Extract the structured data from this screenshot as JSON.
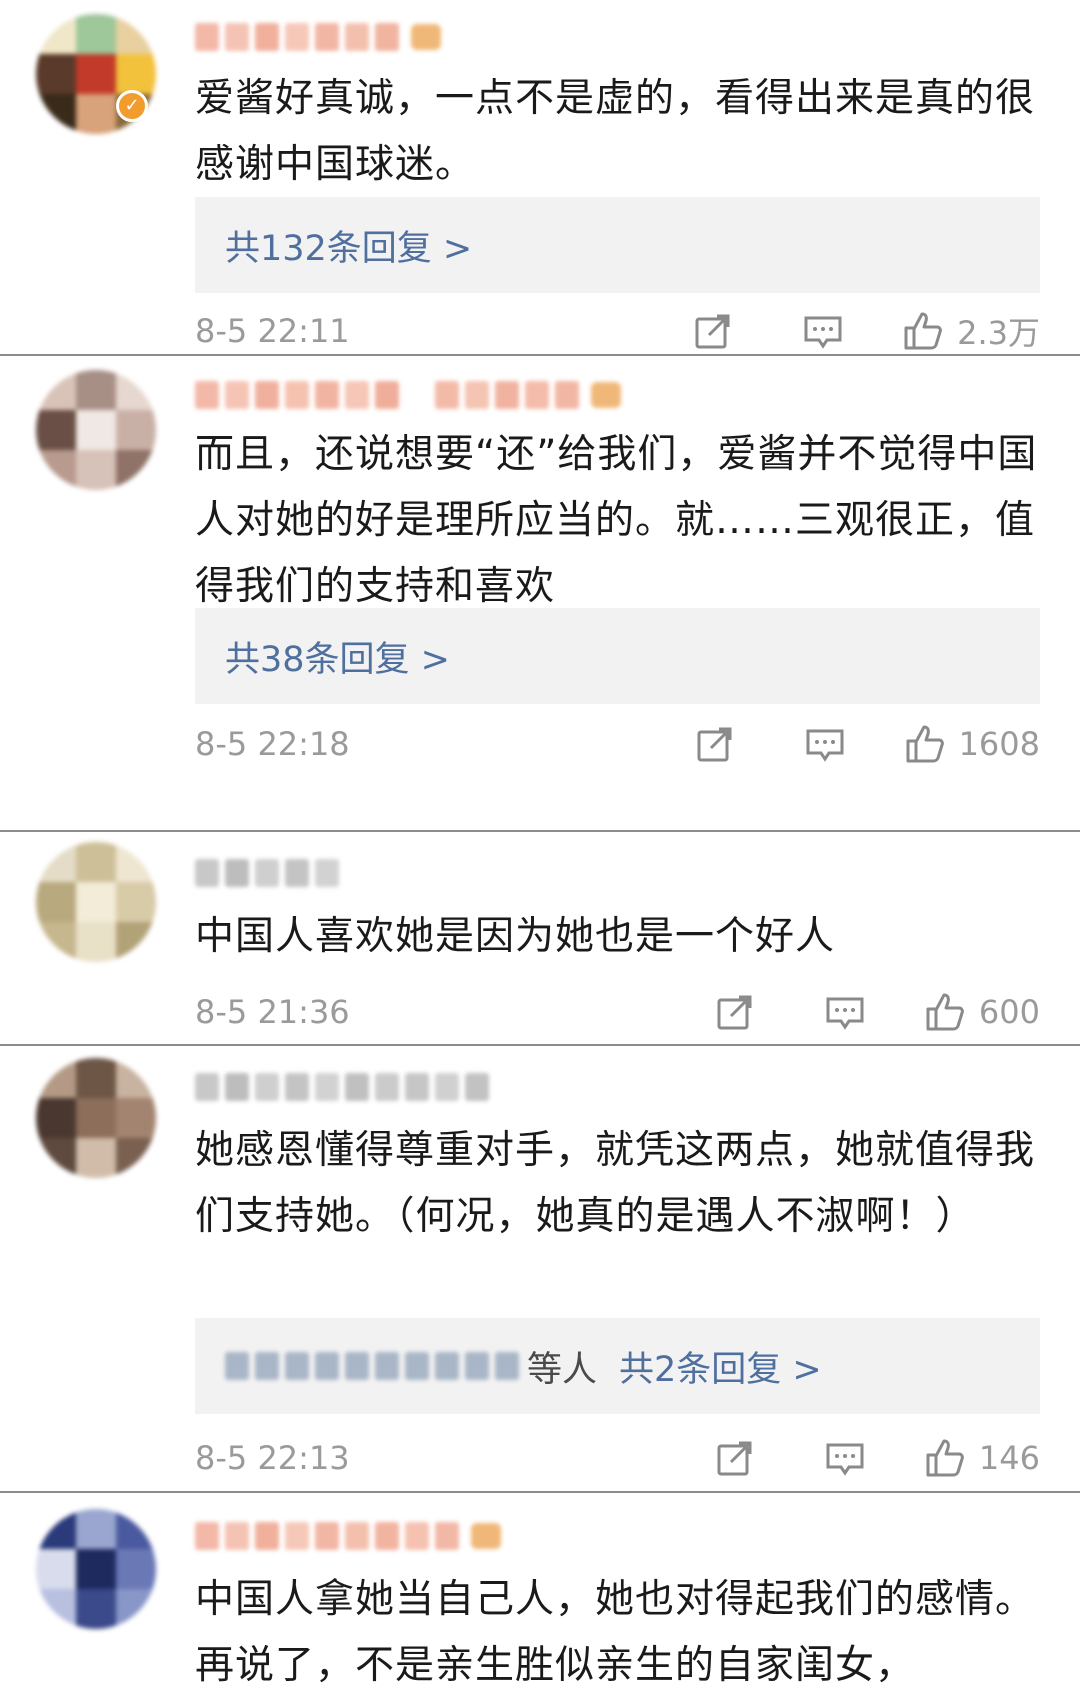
{
  "comments": [
    {
      "username": "",
      "verified": true,
      "text": "爱酱好真诚，一点不是虚的，看得出来是真的很感谢中国球迷。",
      "reply_label": "共132条回复 >",
      "reply_prefix": "",
      "time": "8-5 22:11",
      "likes": "2.3万",
      "avatar_colors": [
        "#f0e6c8",
        "#9ec79a",
        "#e8d0a0",
        "#5a3a2a",
        "#c23a2a",
        "#f2c23c",
        "#3a2a1a",
        "#d8a27a",
        "#8a6a3a"
      ]
    },
    {
      "username": "",
      "verified": false,
      "text": "而且，还说想要“还”给我们，爱酱并不觉得中国人对她的好是理所应当的。就……三观很正，值得我们的支持和喜欢",
      "reply_label": "共38条回复 >",
      "reply_prefix": "",
      "time": "8-5 22:18",
      "likes": "1608",
      "avatar_colors": [
        "#d9c3b8",
        "#a88f86",
        "#e6d8d0",
        "#6a4f46",
        "#f0e8e4",
        "#c9b0a6",
        "#b89a8e",
        "#d6c2b8",
        "#8f7268"
      ]
    },
    {
      "username": "",
      "verified": false,
      "text": "中国人喜欢她是因为她也是一个好人",
      "reply_label": "",
      "reply_prefix": "",
      "time": "8-5 21:36",
      "likes": "600",
      "avatar_colors": [
        "#e4dcc6",
        "#cdbf98",
        "#eee6d0",
        "#b9a97e",
        "#f2ecd8",
        "#d8cba8",
        "#c6b78e",
        "#e9e0c8",
        "#b2a278"
      ]
    },
    {
      "username": "",
      "verified": false,
      "text": "她感恩懂得尊重对手，就凭这两点，她就值得我们支持她。（何况，她真的是遇人不淑啊！）",
      "reply_label": "共2条回复 >",
      "reply_prefix": "等人",
      "time": "8-5 22:13",
      "likes": "146",
      "avatar_colors": [
        "#b49a86",
        "#6e5646",
        "#c8b2a0",
        "#4a3830",
        "#8c6e5a",
        "#a38470",
        "#5e4a3e",
        "#d0bca8",
        "#7a6050"
      ]
    },
    {
      "username": "",
      "verified": true,
      "text": "中国人拿她当自己人，她也对得起我们的感情。再说了，不是亲生胜似亲生的自家闺女，",
      "reply_label": "",
      "reply_prefix": "",
      "time": "",
      "likes": "",
      "avatar_colors": [
        "#2a3a7a",
        "#9aa6d0",
        "#4a5aa0",
        "#d8dcec",
        "#1e2a5e",
        "#6a78b6",
        "#b8c0e0",
        "#3a4a8a",
        "#8896c8"
      ]
    }
  ],
  "icons": {
    "share": "share-icon",
    "comment": "comment-icon",
    "like": "thumbs-up-icon",
    "verified": "verified-badge-icon"
  },
  "colors": {
    "link": "#4f6f9f",
    "meta": "#9a9a9a",
    "text": "#1a1a1a",
    "reply_bg": "#f2f2f2",
    "divider": "#8c8c8c",
    "verified": "#f39c2e"
  }
}
